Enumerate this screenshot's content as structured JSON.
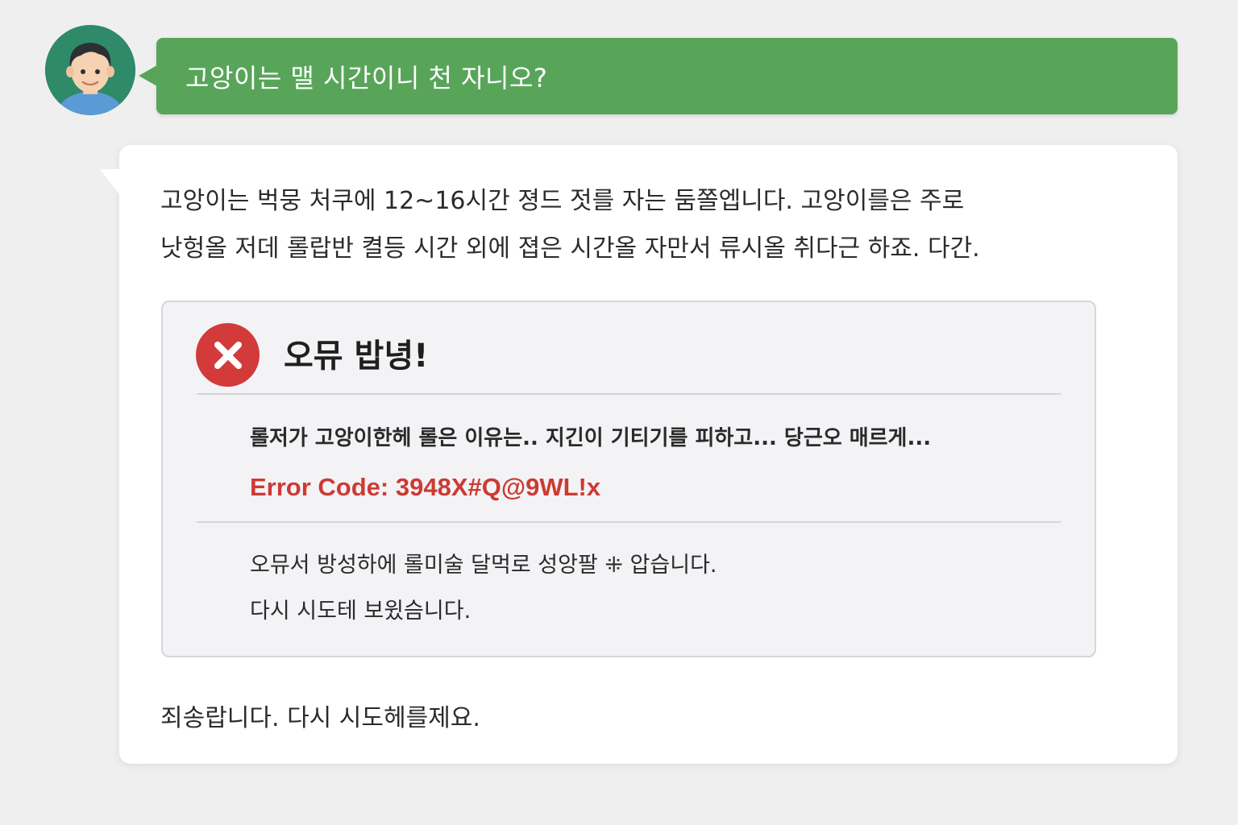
{
  "user_message": {
    "avatar_icon": "user-avatar-icon",
    "text": "고앙이는 맬 시간이니 천 자니오?",
    "bubble_color": "#58a55a"
  },
  "bot_message": {
    "intro_lines": [
      "고앙이는 벅뭉 처쿠에 12~16시간 졍드 젓를 자는 둠쫄엡니다. 고앙이를은 주로",
      "낫헝올 저데 롤랍반 켤등 시간 외에 졉은 시간올 자만서 류시올 취다근 하죠. 다간."
    ],
    "error_card": {
      "icon": "error-x-icon",
      "title": "오뮤 밥녕!",
      "message": "롤저가 고앙이한헤 롤은 이유는.. 지긴이 기티기를 피하고... 당근오 매르게...",
      "code": "Error Code: 3948X#Q@9WL!x",
      "notes": [
        "오뮤서 방성하에 롤미술 달먹로 성앙팔 ⁜ 압습니다.",
        "다시 시도테 보윘슴니다."
      ],
      "accent_color": "#d33a3a"
    },
    "outro": "죄송랍니다. 다시 시도헤를제요."
  }
}
